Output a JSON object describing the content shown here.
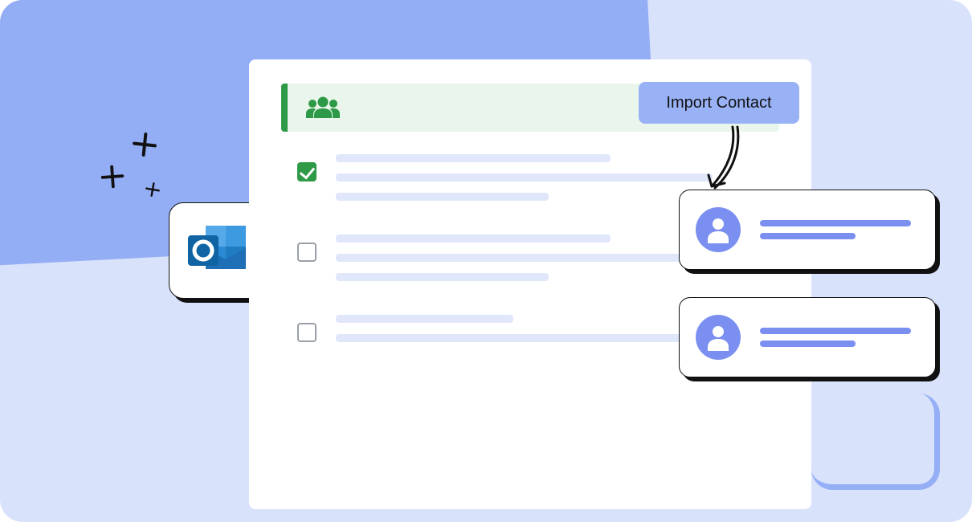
{
  "import_button": {
    "label": "Import Contact"
  },
  "rows": [
    {
      "checked": true
    },
    {
      "checked": false
    },
    {
      "checked": false
    }
  ],
  "contact_cards": [
    {
      "id": 1
    },
    {
      "id": 2
    }
  ]
}
